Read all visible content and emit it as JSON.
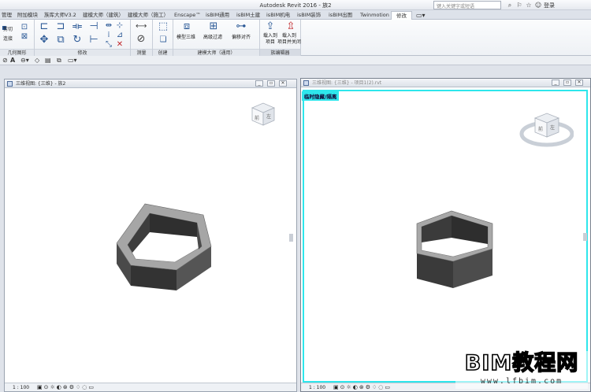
{
  "app": {
    "title": "Autodesk Revit 2016 -   族2",
    "search_placeholder": "键入关键字或短语",
    "login_label": "登录"
  },
  "tabs": [
    {
      "label": "管理"
    },
    {
      "label": "附加模块"
    },
    {
      "label": "族库大师V3.2"
    },
    {
      "label": "建模大师（建筑）"
    },
    {
      "label": "建模大师（施工）"
    },
    {
      "label": "Enscape™"
    },
    {
      "label": "isBIM通用"
    },
    {
      "label": "isBIM土建"
    },
    {
      "label": "isBIM机电"
    },
    {
      "label": "isBIM装饰"
    },
    {
      "label": "isBIM出图"
    },
    {
      "label": "Twinmotion"
    },
    {
      "label": "修改"
    }
  ],
  "ribbon": {
    "panels": {
      "geometry": "几何图形",
      "modify": "修改",
      "measure": "测量",
      "create": "创建",
      "modelmaster": "建模大师（通用）",
      "family_editor": "族编辑器"
    },
    "cut_label": "剪切",
    "join_label": "连接",
    "buttons": {
      "create_3d": "模型三维",
      "advanced_filter": "高级过滤",
      "offset_align": "偏移对齐",
      "load_to_project": "载入到\n项目",
      "load_to_project_close": "载入到\n项目并关闭"
    }
  },
  "views": {
    "left": {
      "title": "三维视图: {三维} - 族2",
      "scale": "1 : 100"
    },
    "right": {
      "title": "三维视图: {三维} - 项目1(2).rvt",
      "scale": "1 : 100",
      "badge": "临时隐藏/隔离"
    }
  },
  "viewcube": {
    "left_faces": [
      "左",
      "前"
    ],
    "right_faces": [
      "左",
      "前"
    ]
  },
  "watermark": {
    "main": "BIM教程网",
    "url": "www.lfbim.com"
  },
  "colors": {
    "highlight_border": "#2ee6ec",
    "wall_top": "#a9a9a9",
    "wall_side": "#3b3b3b"
  }
}
